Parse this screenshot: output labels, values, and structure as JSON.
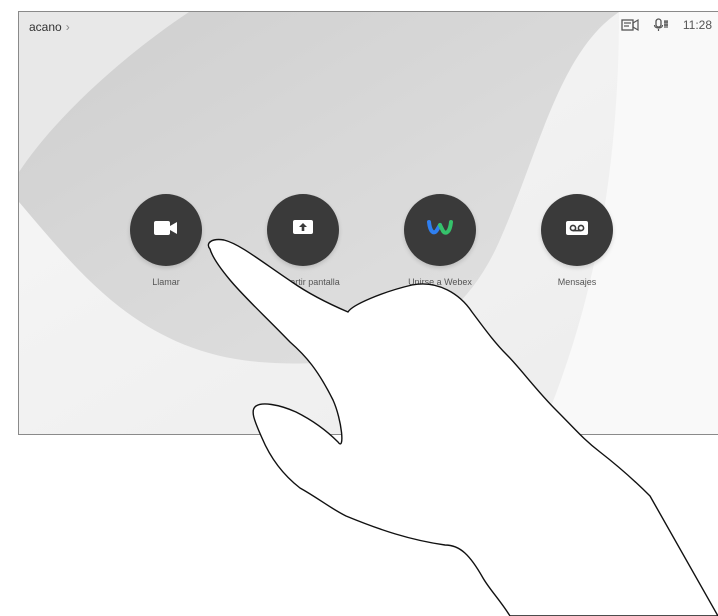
{
  "header": {
    "device_name": "acano",
    "chevron_glyph": "›",
    "time": "11:28",
    "icons": [
      "screen-share-status-icon",
      "microphone-icon"
    ]
  },
  "actions": [
    {
      "label": "Llamar",
      "icon": "video-camera-icon"
    },
    {
      "label": "Compartir pantalla",
      "icon": "share-screen-icon"
    },
    {
      "label": "Unirse a Webex",
      "icon": "webex-icon"
    },
    {
      "label": "Mensajes",
      "icon": "voicemail-icon"
    }
  ],
  "colors": {
    "button_bg": "#3a3a3a",
    "webex_blue": "#2f7ff0",
    "webex_green": "#35c26b"
  }
}
